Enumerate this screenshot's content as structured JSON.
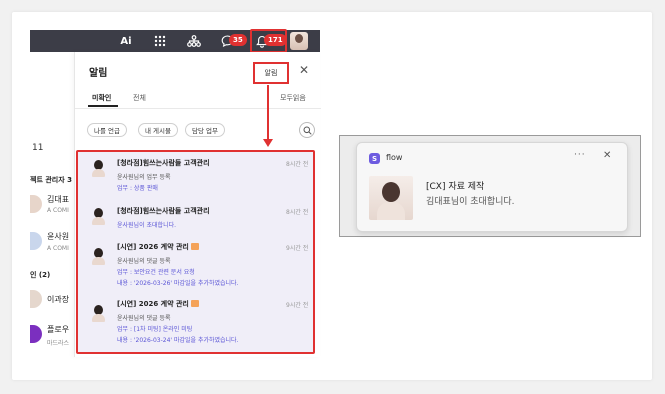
{
  "topbar": {
    "ai_label": "Ai",
    "chat_badge": "35",
    "bell_badge": "171"
  },
  "background_list": {
    "count": "11",
    "section1": "젝트 관리자",
    "section1_count": "3",
    "people": [
      {
        "name": "김대표",
        "sub": "A COMI"
      },
      {
        "name": "윤사원",
        "sub": "A COMI"
      }
    ],
    "section2": "인",
    "section2_count": "(2)",
    "people2": [
      {
        "name": "이과장",
        "sub": ""
      },
      {
        "name": "플로우",
        "sub": "마드라스"
      }
    ]
  },
  "panel": {
    "title": "알림",
    "tooltip": "알림",
    "tabs": [
      "미확인",
      "전체"
    ],
    "mark_all": "모두읽음",
    "chips": [
      "나를 언급",
      "내 게시물",
      "담당 업무"
    ]
  },
  "notifications": [
    {
      "title": "[청라점]힘쓰는사람들 고객관리",
      "time": "8시간 전",
      "line1": "윤사원님의 업무 등록",
      "line2": "업무 : 상품 판매"
    },
    {
      "title": "[청라점]힘쓰는사람들 고객관리",
      "time": "8시간 전",
      "line1": "윤사원님이 초대합니다.",
      "line2": ""
    },
    {
      "title": "[시연] 2026 계약 관리",
      "time": "9시간 전",
      "line1": "윤사원님의 댓글 등록",
      "line2": "업무 : 보안요건 관련 문서 요청",
      "line3": "내용 : '2026-03-26' 마감일을 추가하였습니다."
    },
    {
      "title": "[시연] 2026 계약 관리",
      "time": "9시간 전",
      "line1": "윤사원님의 댓글 등록",
      "line2": "업무 : [1차 미팅] 온라인 미팅",
      "line3": "내용 : '2026-03-24' 마감일을 추가하였습니다."
    }
  ],
  "toast": {
    "app": "flow",
    "more": "···",
    "close": "✕",
    "title": "[CX] 자료 제작",
    "body": "김대표님이 초대합니다."
  },
  "colors": {
    "accent_red": "#e03131",
    "highlight_purple": "#5b56d6",
    "topbar": "#3c3d47"
  }
}
